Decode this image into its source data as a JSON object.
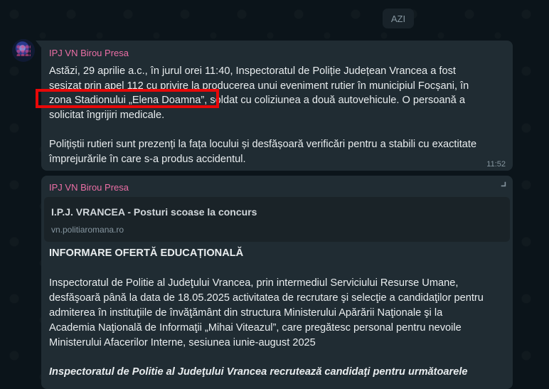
{
  "date_chip": "AZI",
  "messages": [
    {
      "sender": "IPJ VN Birou Presa",
      "lines": [
        "Astăzi, 29 aprilie a.c., în jurul orei 11:40, Inspectoratul de Poliție Județean Vrancea a fost",
        "sesizat prin apel 112 cu privire la producerea unui eveniment rutier în municipiul Focșani, în",
        "zona Stadionului „Elena Doamna”, soldat cu coliziunea a două autovehicule. O persoană a",
        "solicitat îngrijiri medicale.",
        "",
        "Polițiștii rutieri sunt prezenți la fața locului și desfășoară verificări pentru a stabili cu exactitate",
        "împrejurările în care s-a produs accidentul."
      ],
      "time": "11:52"
    },
    {
      "sender": "IPJ VN Birou Presa",
      "link_preview": {
        "title": "I.P.J. VRANCEA - Posturi scoase la concurs",
        "url": "vn.politiaromana.ro"
      },
      "heading": "INFORMARE OFERTĂ EDUCAȚIONALĂ",
      "body_lines": [
        "Inspectoratul de Politie al Judeţului Vrancea, prin intermediul Serviciului Resurse Umane,",
        "desfăşoară până la data de 18.05.2025 activitatea de recrutare şi selecţie a candidaţilor pentru",
        "admiterea în instituţiile de învăţământ din structura Ministerului Apărării Naţionale şi la",
        "Academia Naţională de Informaţii „Mihai Viteazul”, care pregătesc personal pentru nevoile",
        "Ministerului Afacerilor Interne, sesiunea iunie-august 2025"
      ],
      "recruit_line": "Inspectoratul de Politie al Judeţului Vrancea recrutează candidaţi pentru următoarele"
    }
  ],
  "colors": {
    "background": "#0b141a",
    "bubble": "#202c33",
    "sender": "#ec6fa6",
    "highlight": "#e80808"
  },
  "icons": [
    "chevron-down-icon"
  ]
}
